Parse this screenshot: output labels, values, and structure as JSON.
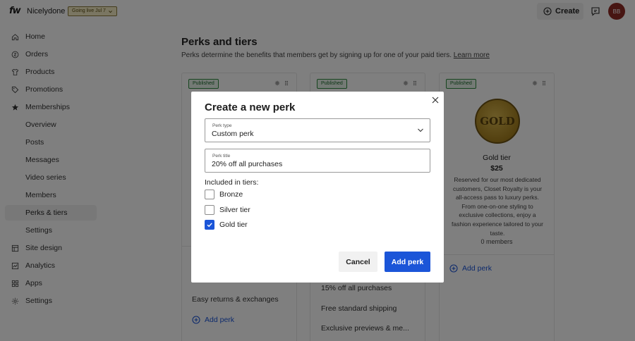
{
  "topbar": {
    "logo": "fw",
    "brand": "Nicelydone",
    "live_badge": "Going live Jul 7",
    "create_label": "Create",
    "avatar_initials": "BB"
  },
  "sidebar": {
    "items": [
      {
        "label": "Home",
        "icon": "home-icon"
      },
      {
        "label": "Orders",
        "icon": "orders-icon"
      },
      {
        "label": "Products",
        "icon": "products-icon"
      },
      {
        "label": "Promotions",
        "icon": "promotions-icon"
      },
      {
        "label": "Memberships",
        "icon": "star-icon"
      },
      {
        "label": "Overview"
      },
      {
        "label": "Posts"
      },
      {
        "label": "Messages"
      },
      {
        "label": "Video series"
      },
      {
        "label": "Members"
      },
      {
        "label": "Perks & tiers",
        "active": true
      },
      {
        "label": "Settings"
      },
      {
        "label": "Site design",
        "icon": "site-design-icon"
      },
      {
        "label": "Analytics",
        "icon": "analytics-icon"
      },
      {
        "label": "Apps",
        "icon": "apps-icon"
      },
      {
        "label": "Settings",
        "icon": "gear-icon"
      }
    ]
  },
  "main": {
    "title": "Perks and tiers",
    "description": "Perks determine the benefits that members get by signing up for one of your paid tiers.",
    "learn_more": "Learn more",
    "cards": [
      {
        "badge": "Published",
        "perks": [
          "Easy returns & exchanges"
        ],
        "add_perk": "Add perk"
      },
      {
        "badge": "Published",
        "perks": [
          "15% off all purchases",
          "Free standard shipping",
          "Exclusive previews & me..."
        ]
      },
      {
        "badge": "Published",
        "medal_text": "GOLD",
        "name": "Gold tier",
        "price": "$25",
        "description": "Reserved for our most dedicated customers, Closet Royalty is your all-access pass to luxury perks. From one-on-one styling to exclusive collections, enjoy a fashion experience tailored to your taste.",
        "members": "0 members",
        "add_perk": "Add perk"
      }
    ]
  },
  "modal": {
    "title": "Create a new perk",
    "perk_type_label": "Perk type",
    "perk_type_value": "Custom perk",
    "perk_title_label": "Perk title",
    "perk_title_value": "20% off all purchases",
    "included_label": "Included in tiers:",
    "tiers": [
      {
        "label": "Bronze",
        "checked": false
      },
      {
        "label": "Silver tier",
        "checked": false
      },
      {
        "label": "Gold tier",
        "checked": true
      }
    ],
    "cancel_label": "Cancel",
    "submit_label": "Add perk"
  },
  "colors": {
    "accent": "#1b55d8",
    "avatar": "#8e2a25",
    "published_bg": "#e8f5ea",
    "live_badge_bg": "#f5ecc4"
  }
}
